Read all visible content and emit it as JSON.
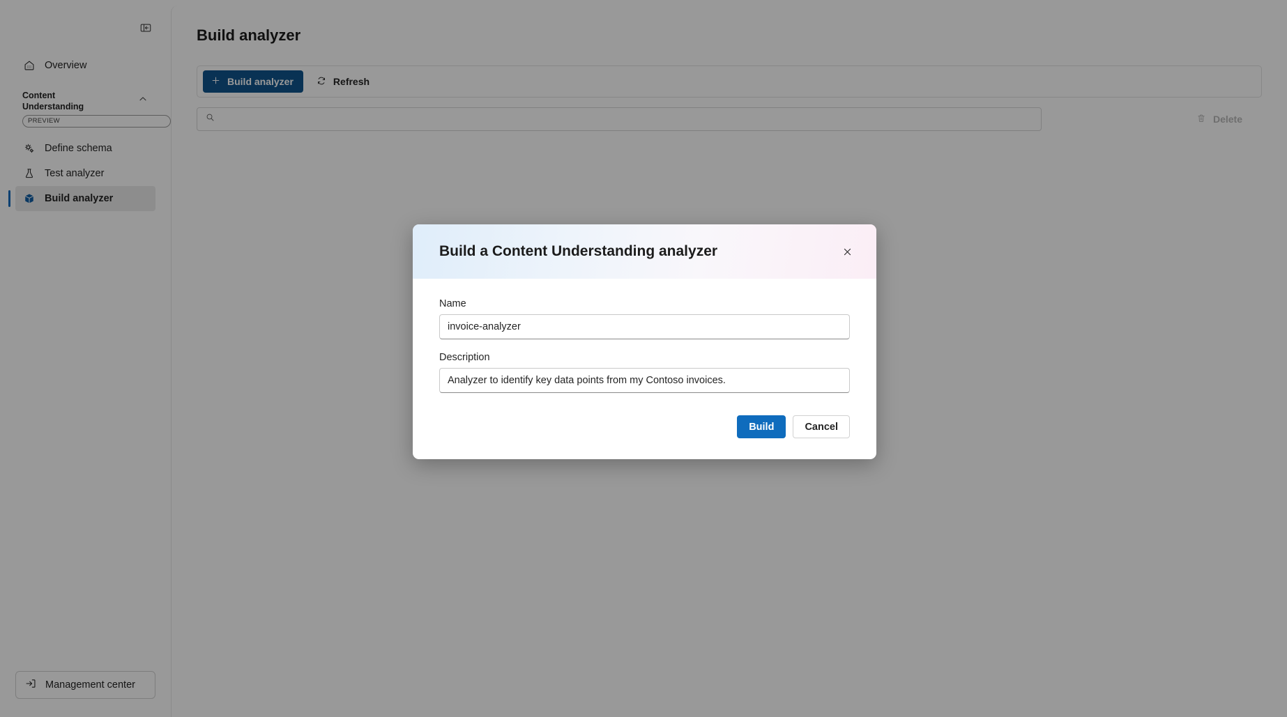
{
  "sidebar": {
    "collapse_icon": "panel-collapse-icon",
    "overview": {
      "label": "Overview",
      "icon": "home-icon"
    },
    "section": {
      "title": "Content Understanding",
      "badge": "PREVIEW",
      "chevron": "chevron-up-icon"
    },
    "items": [
      {
        "label": "Define schema",
        "icon": "schema-gears-icon",
        "selected": false
      },
      {
        "label": "Test analyzer",
        "icon": "beaker-icon",
        "selected": false
      },
      {
        "label": "Build analyzer",
        "icon": "cube-icon",
        "selected": true
      }
    ],
    "management_center": {
      "label": "Management center",
      "icon": "sign-in-arrow-icon"
    }
  },
  "main": {
    "page_title": "Build analyzer",
    "toolbar": {
      "build_label": "Build analyzer",
      "build_icon": "plus-icon",
      "refresh_label": "Refresh",
      "refresh_icon": "refresh-circular-arrow-icon"
    },
    "search": {
      "value": "",
      "placeholder": "",
      "icon": "search-icon"
    },
    "delete": {
      "label": "Delete",
      "icon": "trash-icon",
      "disabled": "true"
    }
  },
  "dialog": {
    "title": "Build a Content Understanding analyzer",
    "close_icon": "close-icon",
    "name_label": "Name",
    "name_value": "invoice-analyzer",
    "name_placeholder": "",
    "description_label": "Description",
    "description_value": "Analyzer to identify key data points from my Contoso invoices.",
    "description_placeholder": "",
    "build_label": "Build",
    "cancel_label": "Cancel"
  },
  "colors": {
    "accent": "#0f6cbd",
    "primary_command": "#0f548c",
    "selected_bg": "#ebebeb",
    "disabled_text": "#b8b8b8"
  }
}
